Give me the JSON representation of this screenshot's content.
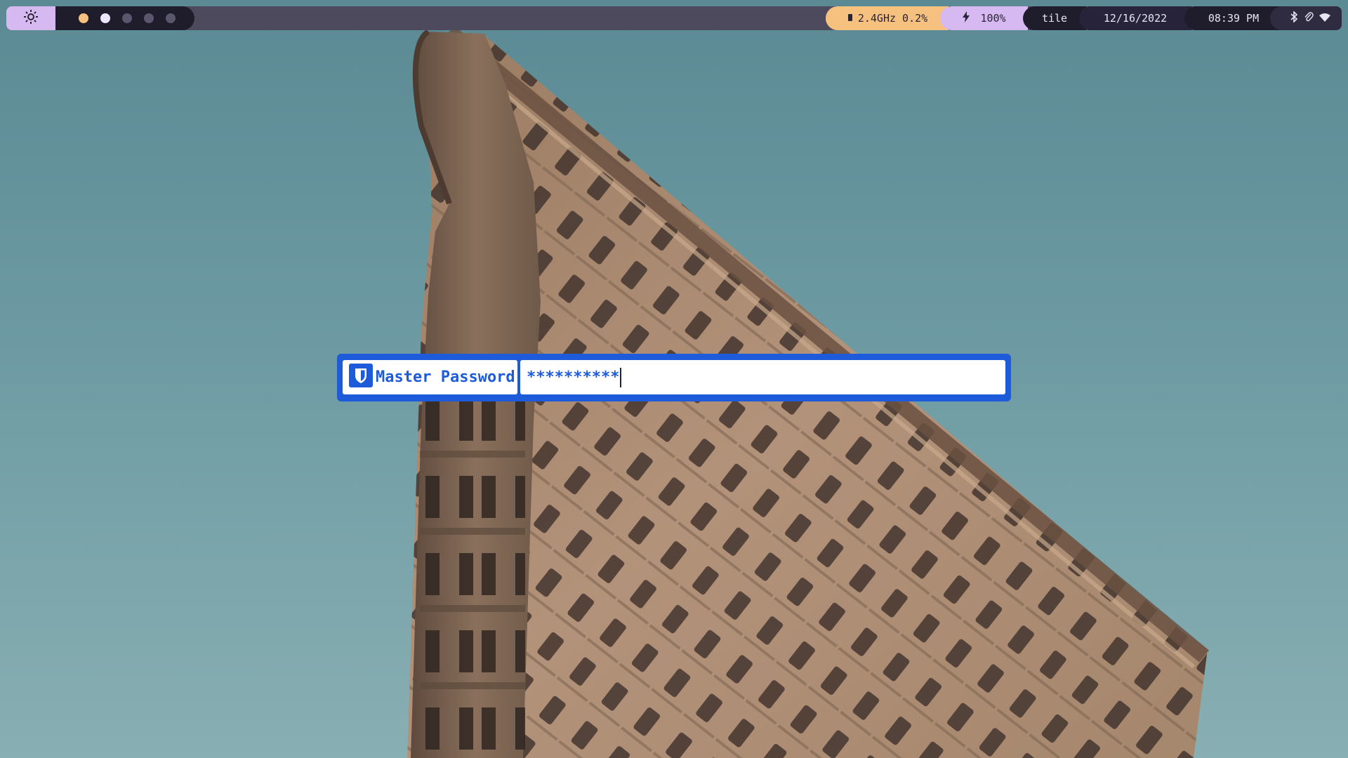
{
  "topbar": {
    "launcher_icon": "gear-icon",
    "workspaces": [
      {
        "state": "occupied",
        "color": "#f6c07e"
      },
      {
        "state": "active",
        "color": "#ece6ff"
      },
      {
        "state": "empty",
        "color": "#5b556e"
      },
      {
        "state": "empty",
        "color": "#5b556e"
      },
      {
        "state": "empty",
        "color": "#5b556e"
      }
    ],
    "cpu": {
      "icon": "cpu-icon",
      "text": "2.4GHz 0.2%"
    },
    "battery": {
      "icon": "lightning-icon",
      "text": "100%"
    },
    "layout": "tile",
    "date": "12/16/2022",
    "time": "08:39 PM",
    "tray_icons": [
      "bluetooth-icon",
      "paperclip-icon",
      "wifi-icon"
    ]
  },
  "prompt": {
    "icon": "bitwarden-shield-icon",
    "label": "Master Password",
    "value": "**********"
  },
  "colors": {
    "bar_bg": "#4e4a5e",
    "accent_purple": "#d6b9f0",
    "accent_orange": "#f6c07e",
    "prompt_blue": "#1d5bdb",
    "sky": "#6e9aa3"
  },
  "wallpaper": "Flatiron building against a teal sky"
}
